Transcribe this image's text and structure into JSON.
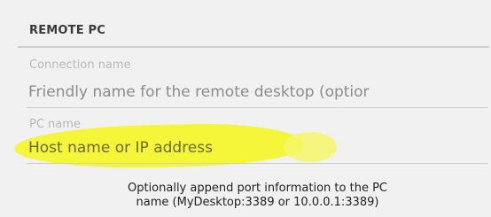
{
  "section": {
    "title": "REMOTE PC"
  },
  "connection_name": {
    "label": "Connection name",
    "placeholder": "Friendly name for the remote desktop (optior",
    "value": ""
  },
  "pc_name": {
    "label": "PC name",
    "placeholder": "Host name or IP address",
    "value": ""
  },
  "helper_text": {
    "line1": "Optionally append port information to the PC",
    "line2": "name (MyDesktop:3389 or 10.0.0.1:3389)"
  },
  "colors": {
    "background": "#f1f1f1",
    "highlight": "#f5f53a",
    "label": "#b9b9b9",
    "rule": "#cfcfcf"
  }
}
